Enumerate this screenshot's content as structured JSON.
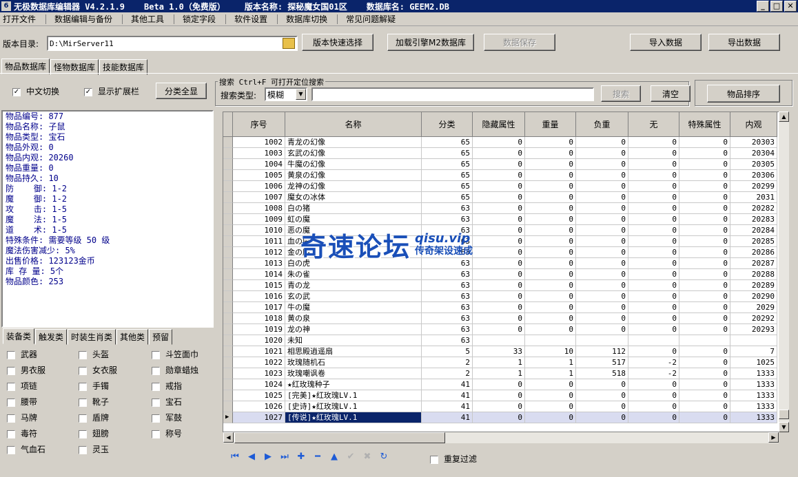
{
  "title": {
    "app": "无极数据库编辑器 V4.2.1.9",
    "beta": "Beta 1.0（免费版）",
    "version": "版本名称: 探秘魔女国01区",
    "db": "数据库名: GEEM2.DB"
  },
  "menu": [
    "打开文件",
    "数据编辑与备份",
    "其他工具",
    "锁定字段",
    "软件设置",
    "数据库切换",
    "常见问题解疑"
  ],
  "toolbar": {
    "dir_label": "版本目录:",
    "dir_value": "D:\\MirServer11",
    "quick_select": "版本快速选择",
    "load_engine": "加载引擎M2数据库",
    "save": "数据保存",
    "import": "导入数据",
    "export": "导出数据"
  },
  "tabs": [
    "物品数据库",
    "怪物数据库",
    "技能数据库"
  ],
  "options": {
    "chinese": "中文切换",
    "show_ext": "显示扩展栏",
    "show_all": "分类全显"
  },
  "search": {
    "legend": "搜索  Ctrl+F 可打开定位搜索",
    "type_label": "搜索类型:",
    "type_value": "模糊",
    "query": "",
    "search_btn": "搜索",
    "clear_btn": "清空",
    "sort_btn": "物品排序"
  },
  "info": [
    "物品编号: 877",
    "物品名称: 子鼠",
    "物品类型: 宝石",
    "物品外观: 0",
    "物品内观: 20260",
    "物品重量: 0",
    "物品持久: 10",
    "防    御: 1-2",
    "魔    御: 1-2",
    "攻    击: 1-5",
    "魔    法: 1-5",
    "道    术: 1-5",
    "特殊条件: 需要等级 50 级",
    "魔法伤害减少: 5%",
    "出售价格: 123123金币",
    "库 存 量: 5个",
    "物品颜色: 253"
  ],
  "cat_tabs": [
    "装备类",
    "触发类",
    "时装生肖类",
    "其他类",
    "预留"
  ],
  "cats": [
    "武器",
    "头盔",
    "斗笠面巾",
    "男衣服",
    "女衣服",
    "勋章蜡烛",
    "项链",
    "手镯",
    "戒指",
    "腰带",
    "靴子",
    "宝石",
    "马牌",
    "盾牌",
    "军鼓",
    "毒符",
    "翅膀",
    "称号",
    "气血石",
    "灵玉"
  ],
  "grid": {
    "columns": [
      "序号",
      "名称",
      "分类",
      "隐藏属性",
      "重量",
      "负重",
      "无",
      "特殊属性",
      "内观"
    ],
    "rows": [
      [
        "1002",
        "青龙の幻像",
        "65",
        "0",
        "0",
        "0",
        "0",
        "0",
        "20303"
      ],
      [
        "1003",
        "玄武の幻像",
        "65",
        "0",
        "0",
        "0",
        "0",
        "0",
        "20304"
      ],
      [
        "1004",
        "牛魔の幻像",
        "65",
        "0",
        "0",
        "0",
        "0",
        "0",
        "20305"
      ],
      [
        "1005",
        "黄泉の幻像",
        "65",
        "0",
        "0",
        "0",
        "0",
        "0",
        "20306"
      ],
      [
        "1006",
        "龙神の幻像",
        "65",
        "0",
        "0",
        "0",
        "0",
        "0",
        "20299"
      ],
      [
        "1007",
        "魔女の冰体",
        "65",
        "0",
        "0",
        "0",
        "0",
        "0",
        "2031"
      ],
      [
        "1008",
        "白の猪",
        "63",
        "0",
        "0",
        "0",
        "0",
        "0",
        "20282"
      ],
      [
        "1009",
        "虹の魔",
        "63",
        "0",
        "0",
        "0",
        "0",
        "0",
        "20283"
      ],
      [
        "1010",
        "恶の魔",
        "63",
        "0",
        "0",
        "0",
        "0",
        "0",
        "20284"
      ],
      [
        "1011",
        "血の魔",
        "63",
        "0",
        "0",
        "0",
        "0",
        "0",
        "20285"
      ],
      [
        "1012",
        "金の魔",
        "63",
        "0",
        "0",
        "0",
        "0",
        "0",
        "20286"
      ],
      [
        "1013",
        "白の虎",
        "63",
        "0",
        "0",
        "0",
        "0",
        "0",
        "20287"
      ],
      [
        "1014",
        "朱の雀",
        "63",
        "0",
        "0",
        "0",
        "0",
        "0",
        "20288"
      ],
      [
        "1015",
        "青の龙",
        "63",
        "0",
        "0",
        "0",
        "0",
        "0",
        "20289"
      ],
      [
        "1016",
        "玄の武",
        "63",
        "0",
        "0",
        "0",
        "0",
        "0",
        "20290"
      ],
      [
        "1017",
        "牛の魔",
        "63",
        "0",
        "0",
        "0",
        "0",
        "0",
        "2029"
      ],
      [
        "1018",
        "黄の泉",
        "63",
        "0",
        "0",
        "0",
        "0",
        "0",
        "20292"
      ],
      [
        "1019",
        "龙の神",
        "63",
        "0",
        "0",
        "0",
        "0",
        "0",
        "20293"
      ],
      [
        "1020",
        "未知",
        "63",
        "",
        "",
        "",
        "",
        "",
        ""
      ],
      [
        "1021",
        "相思殿逍遥扇",
        "5",
        "33",
        "10",
        "112",
        "0",
        "0",
        "7"
      ],
      [
        "1022",
        "玫瑰随机石",
        "2",
        "1",
        "1",
        "517",
        "-2",
        "0",
        "1025"
      ],
      [
        "1023",
        "玫瑰嘲讽卷",
        "2",
        "1",
        "1",
        "518",
        "-2",
        "0",
        "1333"
      ],
      [
        "1024",
        "★红玫瑰种子",
        "41",
        "0",
        "0",
        "0",
        "0",
        "0",
        "1333"
      ],
      [
        "1025",
        "[完美]★红玫瑰LV.1",
        "41",
        "0",
        "0",
        "0",
        "0",
        "0",
        "1333"
      ],
      [
        "1026",
        "[史诗]★红玫瑰LV.1",
        "41",
        "0",
        "0",
        "0",
        "0",
        "0",
        "1333"
      ],
      [
        "1027",
        "[传说]★红玫瑰LV.1",
        "41",
        "0",
        "0",
        "0",
        "0",
        "0",
        "1333"
      ]
    ],
    "selected_row": "1027"
  },
  "bottom": {
    "repeat_filter": "重复过滤"
  },
  "watermark": {
    "main": "奇速论坛",
    "site": "qisu.vip",
    "slogan": "传奇架设速成"
  }
}
